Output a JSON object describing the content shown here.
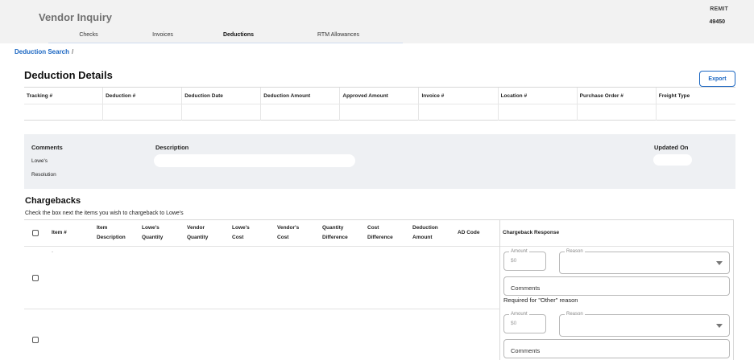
{
  "header": {
    "app_title": "Vendor Inquiry",
    "remit_label": "REMIT",
    "remit_value": "49450",
    "tabs": [
      {
        "label": "Checks"
      },
      {
        "label": "Invoices"
      },
      {
        "label": "Deductions"
      },
      {
        "label": "RTM Allowances"
      }
    ],
    "active_tab": "Deductions"
  },
  "breadcrumb": {
    "item": "Deduction Search",
    "separator": "/"
  },
  "deduction_details": {
    "title": "Deduction Details",
    "export_label": "Export",
    "columns": [
      "Tracking #",
      "Deduction #",
      "Deduction Date",
      "Deduction Amount",
      "Approved Amount",
      "Invoice #",
      "Location #",
      "Purchase Order #",
      "Freight Type"
    ],
    "rows": [
      [
        "",
        "",
        "",
        "",
        "",
        "",
        "",
        "",
        ""
      ]
    ]
  },
  "comments_section": {
    "comments_label": "Comments",
    "lowes_label": "Lowe's",
    "resolution_label": "Resolution",
    "description_label": "Description",
    "updated_on_label": "Updated On"
  },
  "chargebacks": {
    "title": "Chargebacks",
    "instruction": "Check the box next the items you wish to chargeback to Lowe's",
    "columns": [
      [
        "Item #"
      ],
      [
        "Item",
        "Description"
      ],
      [
        "Lowe's",
        "Quantity"
      ],
      [
        "Vendor",
        "Quantity"
      ],
      [
        "Lowe's",
        "Cost"
      ],
      [
        "Vendor's",
        "Cost"
      ],
      [
        "Quantity",
        "Difference"
      ],
      [
        "Cost",
        "Difference"
      ],
      [
        "Deduction",
        "Amount"
      ],
      [
        "AD Code"
      ]
    ],
    "response_header": "Chargeback Response",
    "row_marker": "-",
    "rows": [
      {
        "amount_label": "Amount",
        "amount_value": "$0",
        "reason_label": "Reason",
        "comments_placeholder": "Comments",
        "helper": "Required for \"Other\" reason"
      },
      {
        "amount_label": "Amount",
        "amount_value": "$0",
        "reason_label": "Reason",
        "comments_placeholder": "Comments"
      }
    ]
  }
}
